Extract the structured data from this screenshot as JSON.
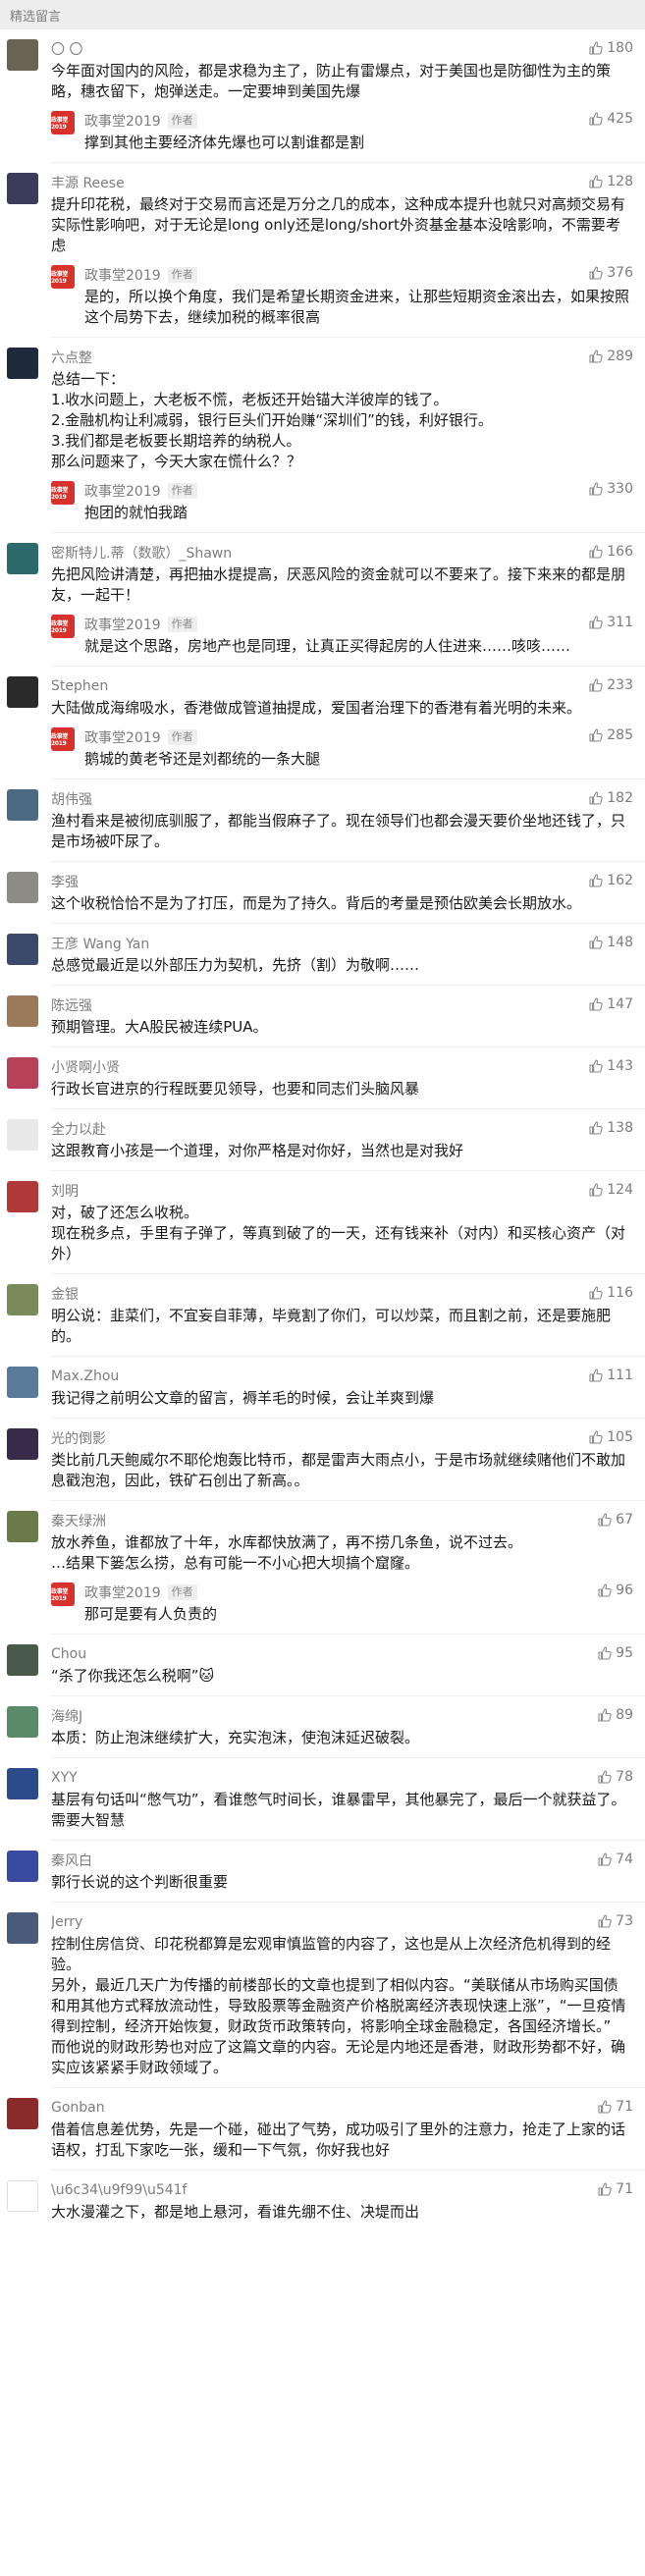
{
  "section_title": "精选留言",
  "author": {
    "name": "政事堂2019",
    "tag": "作者",
    "avatar_text": "政事堂2019"
  },
  "comments": [
    {
      "name": "〇 〇",
      "likes": "180",
      "avatar_color": "#6b6354",
      "text": "今年面对国内的风险，都是求稳为主了，防止有雷爆点，对于美国也是防御性为主的策略，穗衣留下，炮弹送走。一定要坤到美国先爆",
      "reply": {
        "text": "撑到其他主要经济体先爆也可以割谁都是割",
        "likes": "425"
      }
    },
    {
      "name": "丰源 Reese",
      "likes": "128",
      "avatar_color": "#3a3c5a",
      "text": "提升印花税，最终对于交易而言还是万分之几的成本，这种成本提升也就只对高频交易有实际性影响吧，对于无论是long only还是long/short外资基金基本没啥影响，不需要考虑",
      "reply": {
        "text": "是的，所以换个角度，我们是希望长期资金进来，让那些短期资金滚出去，如果按照这个局势下去，继续加税的概率很高",
        "likes": "376"
      }
    },
    {
      "name": "六点整",
      "likes": "289",
      "avatar_color": "#1f2a3a",
      "text": "总结一下：\n1.收水问题上，大老板不慌，老板还开始锚大洋彼岸的钱了。\n2.金融机构让利减弱，银行巨头们开始赚“深圳们”的钱，利好银行。\n3.我们都是老板要长期培养的纳税人。\n那么问题来了，今天大家在慌什么？？",
      "reply": {
        "text": "抱团的就怕我踏",
        "likes": "330"
      }
    },
    {
      "name": "密斯特儿.蒂（数歌）_Shawn",
      "likes": "166",
      "avatar_color": "#2d6a6b",
      "text": "先把风险讲清楚，再把抽水提提高，厌恶风险的资金就可以不要来了。接下来来的都是朋友，一起干！",
      "reply": {
        "text": "就是这个思路，房地产也是同理，让真正买得起房的人住进来……咳咳……",
        "likes": "311"
      }
    },
    {
      "name": "Stephen",
      "likes": "233",
      "avatar_color": "#2a2a2a",
      "text": "大陆做成海绵吸水，香港做成管道抽提成，爱国者治理下的香港有着光明的未来。",
      "reply": {
        "text": "鹅城的黄老爷还是刘都统的一条大腿",
        "likes": "285"
      }
    },
    {
      "name": "胡伟强",
      "likes": "182",
      "avatar_color": "#4d6a85",
      "text": "渔村看来是被彻底驯服了，都能当假麻子了。现在领导们也都会漫天要价坐地还钱了，只是市场被吓尿了。"
    },
    {
      "name": "李强",
      "likes": "162",
      "avatar_color": "#8c8c84",
      "text": "这个收税恰恰不是为了打压，而是为了持久。背后的考量是预估欧美会长期放水。"
    },
    {
      "name": "王彦 Wang Yan",
      "likes": "148",
      "avatar_color": "#3b4a6b",
      "text": "总感觉最近是以外部压力为契机，先挤（割）为敬啊……"
    },
    {
      "name": "陈远强",
      "likes": "147",
      "avatar_color": "#9a7a5a",
      "text": "预期管理。大A股民被连续PUA。"
    },
    {
      "name": "小贤啊小贤",
      "likes": "143",
      "avatar_color": "#b8415a",
      "text": "行政长官进京的行程既要见领导，也要和同志们头脑风暴"
    },
    {
      "name": "全力以赴",
      "likes": "138",
      "avatar_color": "#e8e8e8",
      "text": "这跟教育小孩是一个道理，对你严格是对你好，当然也是对我好"
    },
    {
      "name": "刘明",
      "likes": "124",
      "avatar_color": "#b03a3a",
      "text": "对，破了还怎么收税。\n现在税多点，手里有子弹了，等真到破了的一天，还有钱来补（对内）和买核心资产（对外）"
    },
    {
      "name": "金银",
      "likes": "116",
      "avatar_color": "#7a8a5a",
      "text": "明公说：韭菜们，不宜妄自菲薄，毕竟割了你们，可以炒菜，而且割之前，还是要施肥的。"
    },
    {
      "name": "Max.Zhou",
      "likes": "111",
      "avatar_color": "#5a7a9a",
      "text": "我记得之前明公文章的留言，褥羊毛的时候，会让羊爽到爆"
    },
    {
      "name": "光的倒影",
      "likes": "105",
      "avatar_color": "#3a2a4a",
      "text": "类比前几天鲍威尔不耶伦炮轰比特币，都是雷声大雨点小，于是市场就继续赌他们不敢加息戳泡泡，因此，铁矿石创出了新高。。"
    },
    {
      "name": "秦天绿洲",
      "likes": "67",
      "avatar_color": "#6a7a4a",
      "text": "放水养鱼，谁都放了十年，水库都快放满了，再不捞几条鱼，说不过去。\n…结果下篓怎么捞，总有可能一不小心把大坝搞个窟窿。",
      "reply": {
        "text": "那可是要有人负责的",
        "likes": "96"
      }
    },
    {
      "name": "Chou",
      "likes": "95",
      "avatar_color": "#4a5a4a",
      "text": "“杀了你我还怎么税啊”🐱"
    },
    {
      "name": "海绵J",
      "likes": "89",
      "avatar_color": "#5a8a6a",
      "text": "本质：防止泡沫继续扩大，充实泡沫，使泡沫延迟破裂。"
    },
    {
      "name": "XYY",
      "likes": "78",
      "avatar_color": "#2a4a8a",
      "text": "基层有句话叫“憋气功”，看谁憋气时间长，谁暴雷早，其他暴完了，最后一个就获益了。需要大智慧"
    },
    {
      "name": "秦风白",
      "likes": "74",
      "avatar_color": "#3a4aa0",
      "text": "郭行长说的这个判断很重要"
    },
    {
      "name": "Jerry",
      "likes": "73",
      "avatar_color": "#4a5a7a",
      "text": "控制住房信贷、印花税都算是宏观审慎监管的内容了，这也是从上次经济危机得到的经验。\n另外，最近几天广为传播的前楼部长的文章也提到了相似内容。“美联储从市场购买国债和用其他方式释放流动性，导致股票等金融资产价格脱离经济表现快速上涨”，“一旦疫情得到控制，经济开始恢复，财政货币政策转向，将影响全球金融稳定，各国经济增长。”\n而他说的财政形势也对应了这篇文章的内容。无论是内地还是香港，财政形势都不好，确实应该紧紧手财政领域了。"
    },
    {
      "name": "Gonban",
      "likes": "71",
      "avatar_color": "#8a2a2a",
      "text": "借着信息差优势，先是一个碰，碰出了气势，成功吸引了里外的注意力，抢走了上家的话语权，打乱下家吃一张，缓和一下气氛，你好我也好"
    },
    {
      "name": "\\u6c34\\u9f99\\u541f",
      "likes": "71",
      "avatar_color": "#ffffff",
      "text": "大水漫灌之下，都是地上悬河，看谁先绷不住、决堤而出"
    }
  ]
}
